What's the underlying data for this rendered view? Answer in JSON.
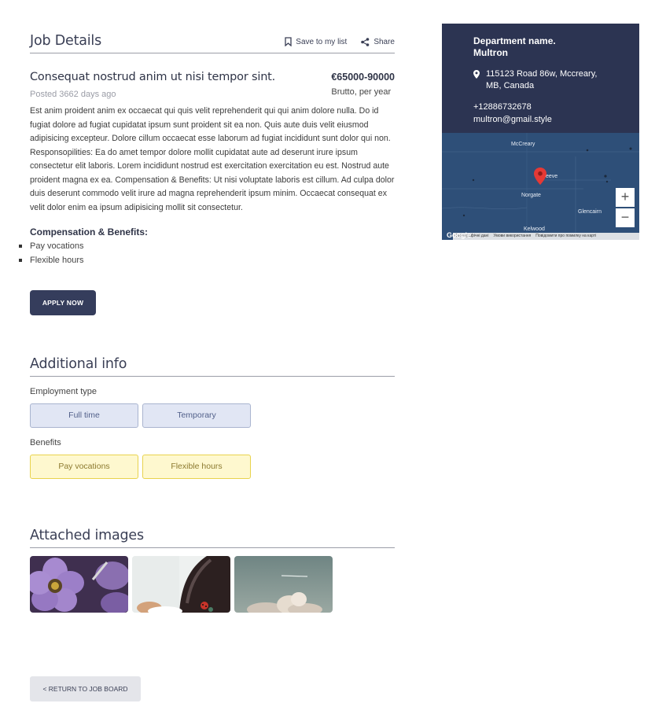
{
  "job_details": {
    "heading": "Job Details",
    "save_label": "Save to my list",
    "share_label": "Share",
    "title": "Consequat nostrud anim ut nisi tempor sint.",
    "posted": "Posted 3662 days ago",
    "salary": "€65000-90000",
    "salary_note": "Brutto, per year",
    "description": "Est anim proident anim ex occaecat qui quis velit reprehenderit qui qui anim dolore nulla. Do id fugiat dolore ad fugiat cupidatat ipsum sunt proident sit ea non. Quis aute duis velit eiusmod adipisicing excepteur. Dolore cillum occaecat esse laborum ad fugiat incididunt sunt dolor qui non. Responsopilities: Ea do amet tempor dolore mollit cupidatat aute ad deserunt irure ipsum consectetur elit laboris. Lorem incididunt nostrud est exercitation exercitation eu est. Nostrud aute proident magna ex ea. Compensation & Benefits: Ut nisi voluptate laboris est cillum. Ad culpa dolor duis deserunt commodo velit irure ad magna reprehenderit ipsum minim. Occaecat consequat ex velit dolor enim ea ipsum adipisicing mollit sit consectetur.",
    "comp_title": "Compensation & Benefits:",
    "benefits": [
      "Pay vocations",
      "Flexible hours"
    ],
    "apply_label": "APPLY NOW"
  },
  "additional_info": {
    "heading": "Additional info",
    "employment_label": "Employment type",
    "employment_types": [
      "Full time",
      "Temporary"
    ],
    "benefits_label": "Benefits",
    "benefits": [
      "Pay vocations",
      "Flexible hours"
    ]
  },
  "attached": {
    "heading": "Attached images"
  },
  "return_label": "< RETURN TO JOB BOARD",
  "department": {
    "name_line1": "Department name.",
    "name_line2": "Multron",
    "address_line1": "115123 Road 86w, Mccreary,",
    "address_line2": "MB, Canada",
    "phone": "+12886732678",
    "email": "multron@gmail.style"
  },
  "map": {
    "labels": [
      "McCreary",
      "eeve",
      "Norgate",
      "Glencairn",
      "Kelwood"
    ],
    "google": "Google",
    "footer": [
      "Картографічні дані",
      "Умови використання",
      "Повідомити про помилку на карті"
    ],
    "zoom_in": "+",
    "zoom_out": "−"
  },
  "colors": {
    "primary": "#353d5c",
    "card_bg": "#2c3452",
    "map_bg": "#2e4f78",
    "chip_blue": "#e1e6f4",
    "chip_yellow": "#fef8cf",
    "marker": "#e53935"
  }
}
